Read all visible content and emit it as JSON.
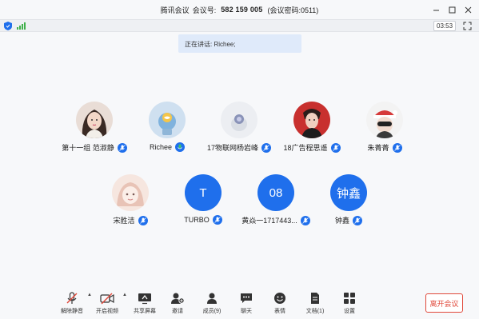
{
  "titlebar": {
    "app_name": "腾讯会议",
    "meeting_id_label": "会议号:",
    "meeting_id": "582 159 005",
    "password_text": "(会议密码:0511)"
  },
  "status": {
    "timer": "03:53",
    "signal_color": "#3fb04a"
  },
  "speaking_banner": "正在讲话: Richee;",
  "participants_row1": [
    {
      "name": "第十一组 范淑静",
      "avatar": "photo-woman"
    },
    {
      "name": "Richee",
      "avatar": "photo-cartoon"
    },
    {
      "name": "17物联网杨岩峰",
      "avatar": "photo-toy"
    },
    {
      "name": "18广告程思遥",
      "avatar": "photo-man-red"
    },
    {
      "name": "朱菁菁",
      "avatar": "photo-santa"
    }
  ],
  "participants_row2": [
    {
      "name": "宋胜洁",
      "avatar": "photo-anime"
    },
    {
      "name": "TURBO",
      "avatar_text": "T"
    },
    {
      "name": "黄焱一1717443...",
      "avatar_text": "08"
    },
    {
      "name": "钟鑫",
      "avatar_text": "钟鑫"
    }
  ],
  "toolbar": {
    "unmute": "解除静音",
    "video": "开启视频",
    "share": "共享屏幕",
    "invite": "邀请",
    "members": "成员(9)",
    "chat": "聊天",
    "emoji": "表情",
    "docs": "文档(1)",
    "settings": "设置"
  },
  "leave_button": "离开会议",
  "colors": {
    "accent": "#1f6fec",
    "leave": "#e0483a",
    "banner": "#dfeafa"
  }
}
